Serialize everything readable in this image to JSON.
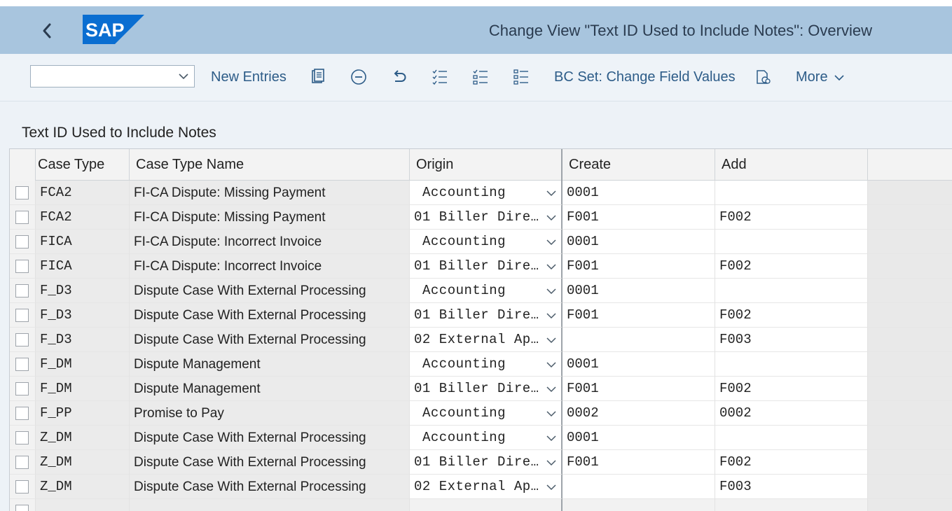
{
  "shell": {
    "title": "Change View \"Text ID Used to Include Notes\": Overview",
    "logo_text": "SAP"
  },
  "toolbar": {
    "command_value": "",
    "new_entries": "New Entries",
    "bc_set": "BC Set: Change Field Values",
    "more": "More"
  },
  "section": {
    "title": "Text ID Used to Include Notes"
  },
  "table": {
    "columns": [
      "Case Type",
      "Case Type Name",
      "Origin",
      "Create",
      "Add"
    ],
    "rows": [
      {
        "type": "FCA2",
        "name": "FI-CA Dispute: Missing Payment",
        "origin": "Accounting",
        "create": "0001",
        "add": ""
      },
      {
        "type": "FCA2",
        "name": "FI-CA Dispute: Missing Payment",
        "origin": "01 Biller Dire…",
        "create": "F001",
        "add": "F002"
      },
      {
        "type": "FICA",
        "name": "FI-CA Dispute: Incorrect Invoice",
        "origin": "Accounting",
        "create": "0001",
        "add": ""
      },
      {
        "type": "FICA",
        "name": "FI-CA Dispute: Incorrect Invoice",
        "origin": "01 Biller Dire…",
        "create": "F001",
        "add": "F002"
      },
      {
        "type": "F_D3",
        "name": "Dispute Case With External Processing",
        "origin": "Accounting",
        "create": "0001",
        "add": ""
      },
      {
        "type": "F_D3",
        "name": "Dispute Case With External Processing",
        "origin": "01 Biller Dire…",
        "create": "F001",
        "add": "F002"
      },
      {
        "type": "F_D3",
        "name": "Dispute Case With External Processing",
        "origin": "02 External Ap…",
        "create": "",
        "add": "F003"
      },
      {
        "type": "F_DM",
        "name": "Dispute Management",
        "origin": "Accounting",
        "create": "0001",
        "add": ""
      },
      {
        "type": "F_DM",
        "name": "Dispute Management",
        "origin": "01 Biller Dire…",
        "create": "F001",
        "add": "F002"
      },
      {
        "type": "F_PP",
        "name": "Promise to Pay",
        "origin": "Accounting",
        "create": "0002",
        "add": "0002"
      },
      {
        "type": "Z_DM",
        "name": "Dispute Case With External Processing",
        "origin": "Accounting",
        "create": "0001",
        "add": ""
      },
      {
        "type": "Z_DM",
        "name": "Dispute Case With External Processing",
        "origin": "01 Biller Dire…",
        "create": "F001",
        "add": "F002"
      },
      {
        "type": "Z_DM",
        "name": "Dispute Case With External Processing",
        "origin": "02 External Ap…",
        "create": "",
        "add": "F003"
      },
      {
        "type": "",
        "name": "",
        "origin": "",
        "create": "",
        "add": ""
      }
    ]
  },
  "colors": {
    "shell_bar": "#a8c5de",
    "toolbar_bg": "#eef3f8",
    "link": "#2d5c88",
    "sap_blue": "#0a6ed1"
  },
  "icons": [
    "back-icon",
    "sap-logo",
    "chevron-down-icon",
    "copy-icon",
    "delete-icon",
    "undo-icon",
    "select-all-icon",
    "deselect-all-icon",
    "select-block-icon",
    "bc-set-icon",
    "dropdown-arrow-icon"
  ]
}
